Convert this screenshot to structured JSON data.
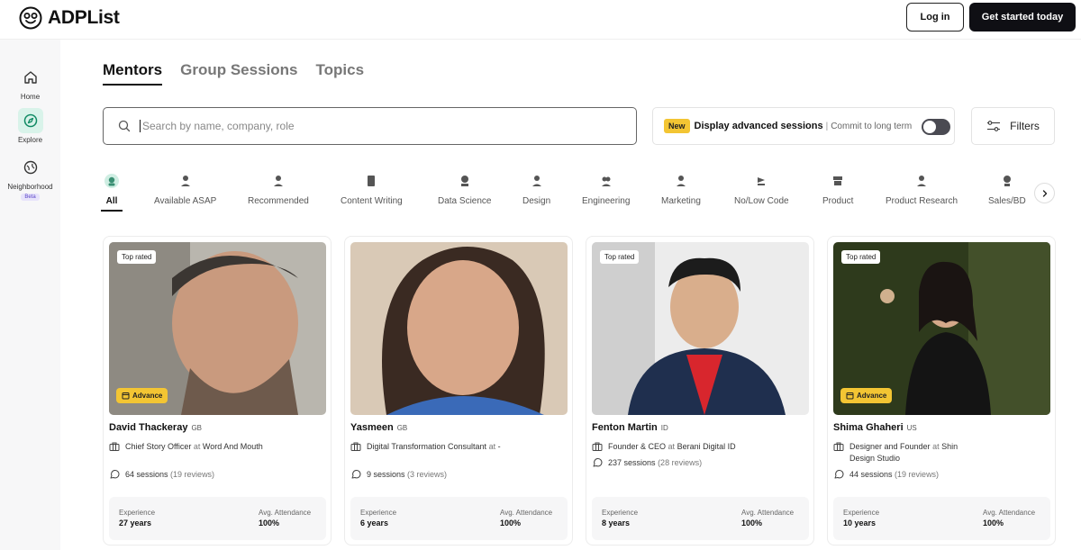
{
  "header": {
    "logo_text": "ADPList",
    "login_label": "Log in",
    "start_label": "Get started today"
  },
  "sidebar": {
    "items": [
      {
        "label": "Home",
        "icon": "home-icon"
      },
      {
        "label": "Explore",
        "icon": "compass-icon",
        "active": true
      },
      {
        "label": "Neighborhood",
        "icon": "globe-icon",
        "badge": "Beta"
      }
    ]
  },
  "tabs": [
    {
      "label": "Mentors",
      "active": true
    },
    {
      "label": "Group Sessions"
    },
    {
      "label": "Topics"
    }
  ],
  "search": {
    "placeholder": "Search by name, company, role"
  },
  "advanced": {
    "badge": "New",
    "title": "Display advanced sessions",
    "separator": "|",
    "subtitle": "Commit to long term"
  },
  "filters_label": "Filters",
  "categories": [
    {
      "label": "All",
      "active": true
    },
    {
      "label": "Available ASAP"
    },
    {
      "label": "Recommended"
    },
    {
      "label": "Content Writing"
    },
    {
      "label": "Data Science"
    },
    {
      "label": "Design"
    },
    {
      "label": "Engineering"
    },
    {
      "label": "Marketing"
    },
    {
      "label": "No/Low Code"
    },
    {
      "label": "Product"
    },
    {
      "label": "Product Research"
    },
    {
      "label": "Sales/BD"
    }
  ],
  "mentors": [
    {
      "top_rated": "Top rated",
      "advance": "Advance",
      "name": "David Thackeray",
      "country": "GB",
      "role": "Chief Story Officer",
      "at": "at",
      "company": "Word And Mouth",
      "sessions": "64 sessions",
      "reviews": "(19 reviews)",
      "exp_label": "Experience",
      "exp_value": "27 years",
      "att_label": "Avg. Attendance",
      "att_value": "100%"
    },
    {
      "top_rated": "",
      "advance": "",
      "name": "Yasmeen",
      "country": "GB",
      "role": "Digital Transformation Consultant",
      "at": "at",
      "company": "-",
      "sessions": "9 sessions",
      "reviews": "(3 reviews)",
      "exp_label": "Experience",
      "exp_value": "6 years",
      "att_label": "Avg. Attendance",
      "att_value": "100%"
    },
    {
      "top_rated": "Top rated",
      "advance": "",
      "name": "Fenton Martin",
      "country": "ID",
      "role": "Founder & CEO",
      "at": "at",
      "company": "Berani Digital ID",
      "sessions": "237 sessions",
      "reviews": "(28 reviews)",
      "exp_label": "Experience",
      "exp_value": "8 years",
      "att_label": "Avg. Attendance",
      "att_value": "100%"
    },
    {
      "top_rated": "Top rated",
      "advance": "Advance",
      "name": "Shima Ghaheri",
      "country": "US",
      "role": "Designer and Founder",
      "at": "at",
      "company": "Shin Design Studio",
      "sessions": "44 sessions",
      "reviews": "(19 reviews)",
      "exp_label": "Experience",
      "exp_value": "10 years",
      "att_label": "Avg. Attendance",
      "att_value": "100%"
    }
  ]
}
